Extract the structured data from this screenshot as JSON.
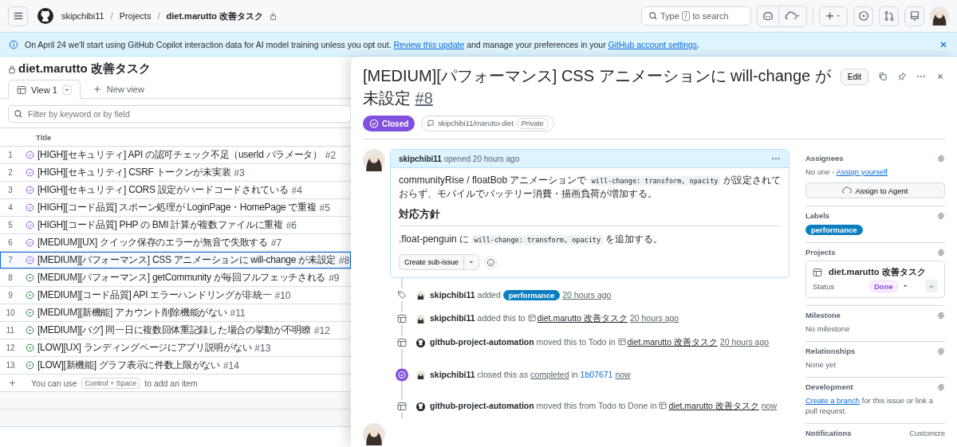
{
  "header": {
    "breadcrumb": [
      {
        "kind": "link",
        "text": "skipchibi11",
        "current": false
      },
      {
        "kind": "separator",
        "text": "/",
        "current": false
      },
      {
        "kind": "link",
        "text": "Projects",
        "current": false
      },
      {
        "kind": "separator",
        "text": "/",
        "current": false
      },
      {
        "kind": "link",
        "text": "diet.marutto 改善タスク",
        "current": true
      }
    ],
    "search": {
      "before": "Type",
      "key": "/",
      "after": "to search"
    }
  },
  "banner": {
    "text_1": "On April 24 we'll start using GitHub Copilot interaction data for AI model training unless you opt out.",
    "link_1": "Review this update",
    "text_2": "and manage your preferences in your",
    "link_2": "GitHub account settings",
    "text_3": "."
  },
  "project": {
    "title": "diet.marutto 改善タスク",
    "tabs": [
      {
        "label": "View 1",
        "selected": true
      },
      {
        "label": "New view",
        "selected": false
      }
    ],
    "filter": {
      "placeholder": "Filter by keyword or by field"
    },
    "column": "Title",
    "rows": [
      {
        "number": "1",
        "kind": "closed",
        "title": "[HIGH][セキュリティ] API の認可チェック不足（userId パラメータ）",
        "ref": "#2",
        "selected": false
      },
      {
        "number": "2",
        "kind": "closed",
        "title": "[HIGH][セキュリティ] CSRF トークンが未実装",
        "ref": "#3",
        "selected": false
      },
      {
        "number": "3",
        "kind": "closed",
        "title": "[HIGH][セキュリティ] CORS 設定がハードコードされている",
        "ref": "#4",
        "selected": false
      },
      {
        "number": "4",
        "kind": "closed",
        "title": "[HIGH][コード品質] スポーン処理が LoginPage・HomePage で重複",
        "ref": "#5",
        "selected": false
      },
      {
        "number": "5",
        "kind": "closed",
        "title": "[HIGH][コード品質] PHP の BMI 計算が複数ファイルに重複",
        "ref": "#6",
        "selected": false
      },
      {
        "number": "6",
        "kind": "closed",
        "title": "[MEDIUM][UX] クイック保存のエラーが無音で失敗する",
        "ref": "#7",
        "selected": false
      },
      {
        "number": "7",
        "kind": "closed",
        "title": "[MEDIUM][パフォーマンス] CSS アニメーションに will-change が未設定",
        "ref": "#8",
        "selected": true
      },
      {
        "number": "8",
        "kind": "open",
        "title": "[MEDIUM][パフォーマンス] getCommunity が毎回フルフェッチされる",
        "ref": "#9",
        "selected": false
      },
      {
        "number": "9",
        "kind": "open",
        "title": "[MEDIUM][コード品質] API エラーハンドリングが非統一",
        "ref": "#10",
        "selected": false
      },
      {
        "number": "10",
        "kind": "open",
        "title": "[MEDIUM][新機能] アカウント削除機能がない",
        "ref": "#11",
        "selected": false
      },
      {
        "number": "11",
        "kind": "open",
        "title": "[MEDIUM][バグ] 同一日に複数回体重記録した場合の挙動が不明瞭",
        "ref": "#12",
        "selected": false
      },
      {
        "number": "12",
        "kind": "open",
        "title": "[LOW][UX] ランディングページにアプリ説明がない",
        "ref": "#13",
        "selected": false
      },
      {
        "number": "13",
        "kind": "open",
        "title": "[LOW][新機能] グラフ表示に件数上限がない",
        "ref": "#14",
        "selected": false
      }
    ],
    "add_hint": {
      "before": "You can use",
      "key": "Control + Space",
      "after": "to add an item"
    }
  },
  "issue": {
    "title": "[MEDIUM][パフォーマンス] CSS アニメーションに will-change が未設定",
    "ref": "#8",
    "edit": "Edit",
    "kind": "closed",
    "state_label": "Closed",
    "repo": "skipchibi11/marutto-diet",
    "visibility": "Private",
    "comment": {
      "author": "skipchibi11",
      "meta": "opened 20 hours ago",
      "paragraph_1": {
        "before": "communityRise / floatBob アニメーションで",
        "code": "will-change: transform, opacity",
        "after": "が設定されておらず、モバイルでバッテリー消費・描画負荷が増加する。"
      },
      "heading": "対応方針",
      "paragraph_2": {
        "before": ".float-penguin に",
        "code": "will-change: transform, opacity",
        "after": "を追加する。"
      },
      "button": "Create sub-issue"
    },
    "events": [
      {
        "kind": "tag",
        "actor": {
          "kind": "user",
          "name": "skipchibi11"
        },
        "parts": [
          {
            "kind": "text",
            "text": "added"
          },
          {
            "kind": "label",
            "text": "performance"
          },
          {
            "kind": "time",
            "text": "20 hours ago"
          }
        ]
      },
      {
        "kind": "table",
        "actor": {
          "kind": "user",
          "name": "skipchibi11"
        },
        "parts": [
          {
            "kind": "text",
            "text": "added this to"
          },
          {
            "kind": "project",
            "text": "diet.marutto 改善タスク"
          },
          {
            "kind": "time",
            "text": "20 hours ago"
          }
        ]
      },
      {
        "kind": "table",
        "actor": {
          "kind": "bot",
          "name": "github-project-automation"
        },
        "parts": [
          {
            "kind": "text",
            "text": "moved this to Todo in"
          },
          {
            "kind": "project",
            "text": "diet.marutto 改善タスク"
          },
          {
            "kind": "time",
            "text": "20 hours ago"
          }
        ]
      },
      {
        "kind": "closed",
        "actor": {
          "kind": "user",
          "name": "skipchibi11"
        },
        "parts": [
          {
            "kind": "text",
            "text": "closed this as"
          },
          {
            "kind": "time",
            "text": "completed"
          },
          {
            "kind": "text",
            "text": "in"
          },
          {
            "kind": "commit",
            "text": "1b07671"
          },
          {
            "kind": "time",
            "text": "now"
          }
        ]
      },
      {
        "kind": "table",
        "actor": {
          "kind": "bot",
          "name": "github-project-automation"
        },
        "parts": [
          {
            "kind": "text",
            "text": "moved this from Todo to Done in"
          },
          {
            "kind": "project",
            "text": "diet.marutto 改善タスク"
          },
          {
            "kind": "time",
            "text": "now"
          }
        ]
      }
    ]
  },
  "sidebar": {
    "assignees": {
      "heading": "Assignees",
      "value": "No one -",
      "link": "Assign yourself",
      "button": "Assign to Agent"
    },
    "labels": {
      "heading": "Labels",
      "items": [
        {
          "text": "performance",
          "color": "#0b7fc1"
        }
      ]
    },
    "projects": {
      "heading": "Projects",
      "project": "diet.marutto 改善タスク",
      "status_label": "Status",
      "status": "Done",
      "expanded": true
    },
    "milestone": {
      "heading": "Milestone",
      "value": "No milestone"
    },
    "relationships": {
      "heading": "Relationships",
      "value": "None yet"
    },
    "development": {
      "heading": "Development",
      "link": "Create a branch",
      "value": "for this issue or link a pull request."
    },
    "notifications": {
      "heading": "Notifications",
      "action": "Customize"
    }
  }
}
